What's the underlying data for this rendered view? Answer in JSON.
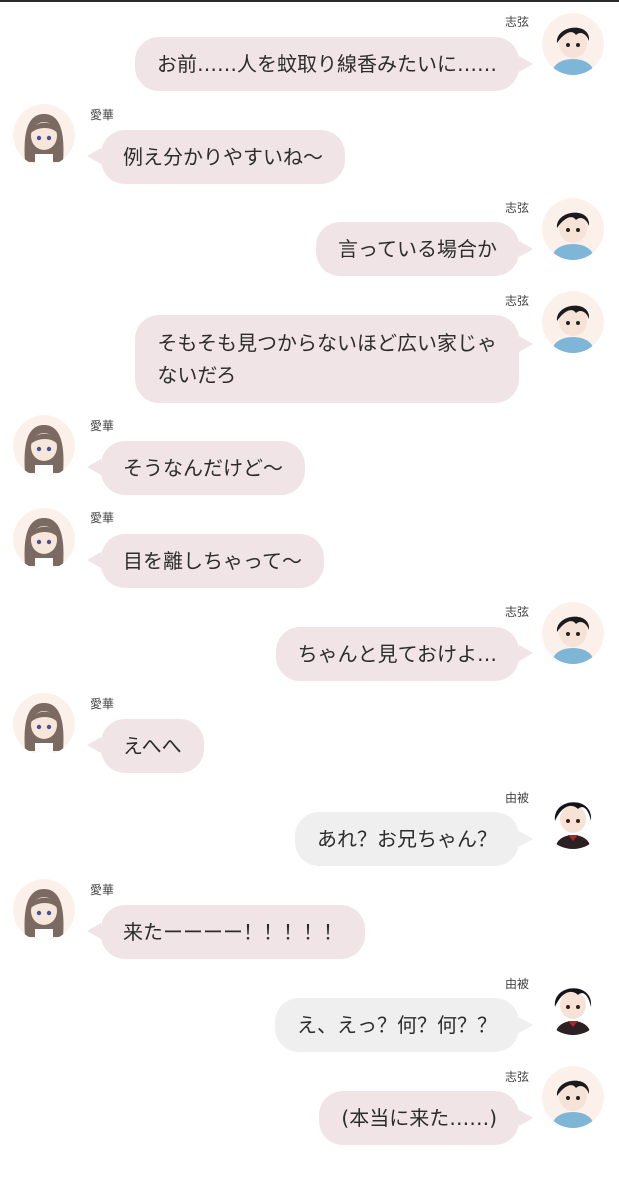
{
  "messages": [
    {
      "side": "right",
      "speaker": "志弦",
      "avatar": "shigen-avatar",
      "text": "お前……人を蚊取り線香みたいに……",
      "color": "pink"
    },
    {
      "side": "left",
      "speaker": "愛華",
      "avatar": "aika-avatar",
      "text": "例え分かりやすいね〜",
      "color": "pink"
    },
    {
      "side": "right",
      "speaker": "志弦",
      "avatar": "shigen-avatar",
      "text": "言っている場合か",
      "color": "pink"
    },
    {
      "side": "right",
      "speaker": "志弦",
      "avatar": "shigen-avatar",
      "text": "そもそも見つからないほど広い家じゃないだろ",
      "line1": "そもそも見つからないほど広い家じゃ",
      "line2": "ないだろ",
      "color": "pink"
    },
    {
      "side": "left",
      "speaker": "愛華",
      "avatar": "aika-avatar",
      "text": "そうなんだけど〜",
      "color": "pink"
    },
    {
      "side": "left",
      "speaker": "愛華",
      "avatar": "aika-avatar",
      "text": "目を離しちゃって〜",
      "color": "pink"
    },
    {
      "side": "right",
      "speaker": "志弦",
      "avatar": "shigen-avatar",
      "text": "ちゃんと見ておけよ…",
      "color": "pink"
    },
    {
      "side": "left",
      "speaker": "愛華",
      "avatar": "aika-avatar",
      "text": "えへへ",
      "color": "pink"
    },
    {
      "side": "right",
      "speaker": "由被",
      "avatar": "yui-avatar",
      "text": "あれ？お兄ちゃん？",
      "color": "gray"
    },
    {
      "side": "left",
      "speaker": "愛華",
      "avatar": "aika-avatar",
      "text": "来たーーーー！！！！！",
      "color": "pink"
    },
    {
      "side": "right",
      "speaker": "由被",
      "avatar": "yui-avatar",
      "text": "え、えっ？何？何？？",
      "color": "gray"
    },
    {
      "side": "right",
      "speaker": "志弦",
      "avatar": "shigen-avatar",
      "text": "(本当に来た……)",
      "color": "pink"
    }
  ],
  "colors": {
    "pink_bubble": "#f1e4e6",
    "gray_bubble": "#efefef",
    "text": "#2c2c2c"
  }
}
